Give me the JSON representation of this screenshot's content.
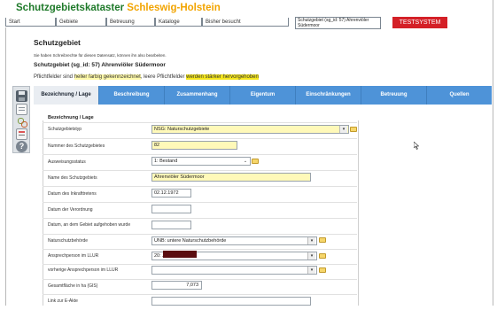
{
  "brand": {
    "part1": "Schutzgebietskataster",
    "part2": "Schleswig-Holstein"
  },
  "nav": [
    {
      "label": "Start"
    },
    {
      "label": "Gebiete"
    },
    {
      "label": "Betreuung"
    },
    {
      "label": "Kataloge"
    },
    {
      "label": "Bisher besucht"
    }
  ],
  "user": {
    "line1": "Schutzgebiet (sg_id: 57) Ahrenviöler",
    "line2": "Südermoor"
  },
  "env_badge": "TESTSYSTEM",
  "page": {
    "title": "Schutzgebiet",
    "note": "Sie haben Schreibrechte für diesen Datensatz, können ihn also bearbeiten.",
    "record": "Schutzgebiet (sg_id: 57) Ahrenviöler Südermoor",
    "legend_pre": "Pflichtfelder sind ",
    "legend_hl1": "heller farbig gekennzeichnet",
    "legend_mid": ", leere Pflichtfelder ",
    "legend_hl2": "werden stärker hervorgehoben"
  },
  "tabs": [
    {
      "label": "Bezeichnung / Lage",
      "active": true
    },
    {
      "label": "Beschreibung"
    },
    {
      "label": "Zusammenhang"
    },
    {
      "label": "Eigentum"
    },
    {
      "label": "Einschränkungen"
    },
    {
      "label": "Betreuung"
    },
    {
      "label": "Quellen"
    }
  ],
  "toolbar": [
    {
      "icon": "save-icon"
    },
    {
      "icon": "document-icon"
    },
    {
      "icon": "link-icon"
    },
    {
      "icon": "list-icon"
    },
    {
      "icon": "help-icon"
    }
  ],
  "form": {
    "section": "Bezeichnung / Lage",
    "fields": {
      "schutzgebietstyp": {
        "label": "Schutzgebietstyp",
        "value": "NSG: Naturschutzgebiete"
      },
      "nummer": {
        "label": "Nummer des Schutzgebietes",
        "value": "82"
      },
      "ausweisungsstatus": {
        "label": "Ausweisungsstatus",
        "value": "1: Bestand"
      },
      "name": {
        "label": "Name des Schutzgebiets",
        "value": "Ahrenviöler Südermoor"
      },
      "inkrafttreten": {
        "label": "Datum des Inkrafttretens",
        "value": "02.12.1972"
      },
      "verordnung": {
        "label": "Datum der Verordnung",
        "value": ""
      },
      "aufgehoben": {
        "label": "Datum, an dem Gebiet aufgehoben wurde",
        "value": ""
      },
      "behoerde": {
        "label": "Naturschutzbehörde",
        "value": "UNB: untere Naturschutzbehörde"
      },
      "ansprech": {
        "label": "Ansprechperson im LLUR",
        "value": "20: J"
      },
      "vorherige": {
        "label": "vorherige Ansprechperson im LLUR",
        "value": ""
      },
      "flaeche": {
        "label": "Gesamtfläche in ha (GIS)",
        "value": "7,073"
      },
      "link": {
        "label": "Link zur E-Akte",
        "value": ""
      }
    }
  }
}
